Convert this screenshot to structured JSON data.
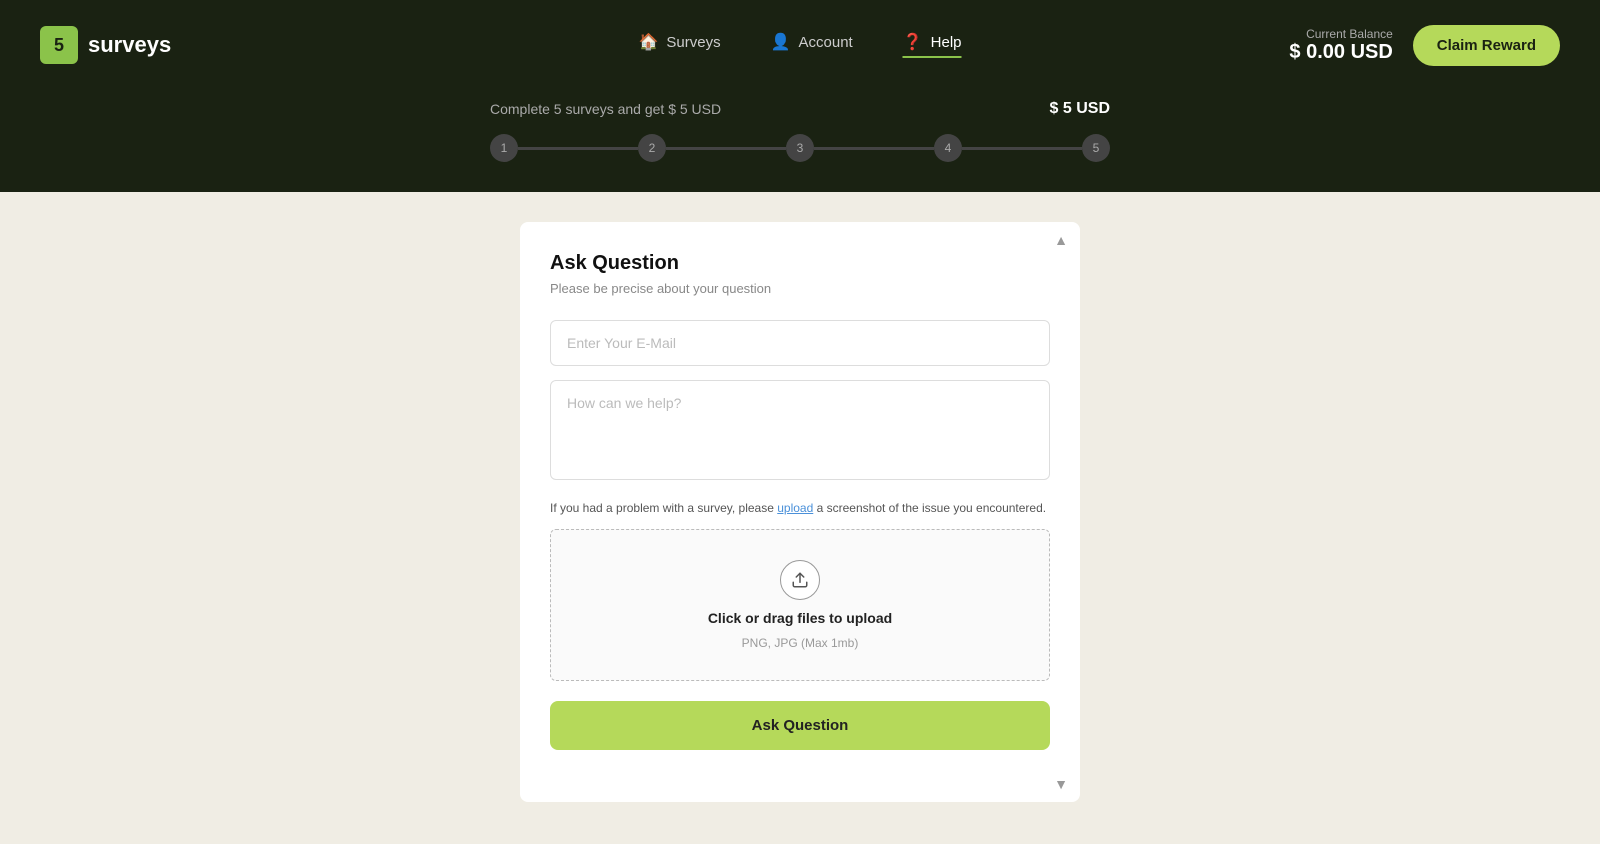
{
  "logo": {
    "badge": "5",
    "text": "surveys"
  },
  "nav": {
    "items": [
      {
        "id": "surveys",
        "label": "Surveys",
        "icon": "🏠",
        "active": false
      },
      {
        "id": "account",
        "label": "Account",
        "icon": "👤",
        "active": false
      },
      {
        "id": "help",
        "label": "Help",
        "icon": "❓",
        "active": true
      }
    ]
  },
  "header": {
    "balance_label": "Current Balance",
    "balance_amount": "$ 0.00 USD",
    "claim_btn_label": "Claim Reward"
  },
  "progress": {
    "description": "Complete 5 surveys and get $ 5 USD",
    "reward": "$ 5 USD",
    "steps": [
      1,
      2,
      3,
      4,
      5
    ]
  },
  "card": {
    "title": "Ask Question",
    "subtitle": "Please be precise about your question",
    "email_placeholder": "Enter Your E-Mail",
    "message_placeholder": "How can we help?",
    "upload_hint": "If you had a problem with a survey, please upload a screenshot of the issue you encountered.",
    "upload_link_text": "upload",
    "upload_main_text": "Click or drag files to upload",
    "upload_sub_text": "PNG, JPG (Max 1mb)",
    "submit_label": "Ask Question"
  }
}
